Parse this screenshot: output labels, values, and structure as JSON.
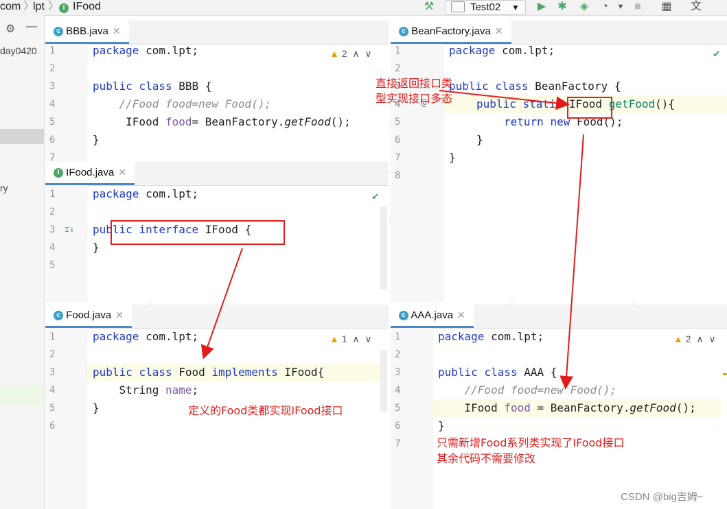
{
  "breadcrumb": {
    "part1": "com",
    "part2": "lpt",
    "part3": "IFood"
  },
  "toolbar": {
    "run_config": "Test02",
    "icons": [
      "hammer-icon",
      "run-icon",
      "debug-icon",
      "coverage-icon",
      "profile-icon",
      "more-icon",
      "stop-icon",
      "project-structure-icon",
      "translate-icon"
    ]
  },
  "left_panel": {
    "text1": "day0420",
    "text2": "ry"
  },
  "panels": {
    "bbb": {
      "tab": "BBB.java",
      "warnings": "2",
      "lines": [
        "1",
        "2",
        "3",
        "4",
        "5",
        "6",
        "7"
      ],
      "code": {
        "l1_kw": "package",
        "l1_rest": " com.lpt;",
        "l3_kw1": "public",
        "l3_kw2": "class",
        "l3_rest": " BBB {",
        "l4": "    //Food food=new Food();",
        "l5_type": "     IFood ",
        "l5_var": "food",
        "l5_mid": "= BeanFactory.",
        "l5_method": "getFood",
        "l5_end": "();",
        "l6": "}"
      }
    },
    "ifood": {
      "tab": "IFood.java",
      "lines": [
        "1",
        "2",
        "3",
        "4",
        "5"
      ],
      "code": {
        "l1_kw": "package",
        "l1_rest": " com.lpt;",
        "l3_kw1": "public",
        "l3_kw2": "interface",
        "l3_rest": " IFood {",
        "l4": "}"
      }
    },
    "food": {
      "tab": "Food.java",
      "warnings": "1",
      "lines": [
        "1",
        "2",
        "3",
        "4",
        "5",
        "6"
      ],
      "code": {
        "l1_kw": "package",
        "l1_rest": " com.lpt;",
        "l3_kw1": "public",
        "l3_kw2": "class",
        "l3_name": " Food ",
        "l3_kw3": "implements",
        "l3_rest": " IFood{",
        "l4_type": "    String ",
        "l4_var": "name",
        "l4_end": ";",
        "l5": "}"
      }
    },
    "beanfactory": {
      "tab": "BeanFactory.java",
      "lines": [
        "1",
        "2",
        "3",
        "4",
        "5",
        "6",
        "7",
        "8"
      ],
      "code": {
        "l1_kw": "package",
        "l1_rest": " com.lpt;",
        "l3_kw1": "public",
        "l3_kw2": "class",
        "l3_rest": " BeanFactory {",
        "l4_kw1": "public",
        "l4_kw2": "static",
        "l4_type": "IFood",
        "l4_method": "getFood",
        "l4_end": "(){",
        "l5_kw1": "return",
        "l5_kw2": "new",
        "l5_rest": " Food();",
        "l6": "}",
        "l7": "}"
      }
    },
    "aaa": {
      "tab": "AAA.java",
      "warnings": "2",
      "lines": [
        "1",
        "2",
        "3",
        "4",
        "5",
        "6",
        "7"
      ],
      "code": {
        "l1_kw": "package",
        "l1_rest": " com.lpt;",
        "l3_kw1": "public",
        "l3_kw2": "class",
        "l3_rest": " AAA {",
        "l4": "    //Food food=new Food();",
        "l5_type": "    IFood ",
        "l5_var": "food",
        "l5_mid": " = BeanFactory.",
        "l5_method": "getFood",
        "l5_end": "();",
        "l6": "}"
      }
    }
  },
  "annotations": {
    "beanfactory_note_1": "直接返回接口类",
    "beanfactory_note_2": "型实现接口多态",
    "food_note": "定义的Food类都实现IFood接口",
    "aaa_note_1": "只需新增Food系列类实现了IFood接口",
    "aaa_note_2": "其余代码不需要修改"
  },
  "watermark": "CSDN @big吉姆~",
  "colors": {
    "keyword": "#1d39c4",
    "annotation_red": "#e21c1c",
    "tab_underline": "#4a88c7"
  }
}
